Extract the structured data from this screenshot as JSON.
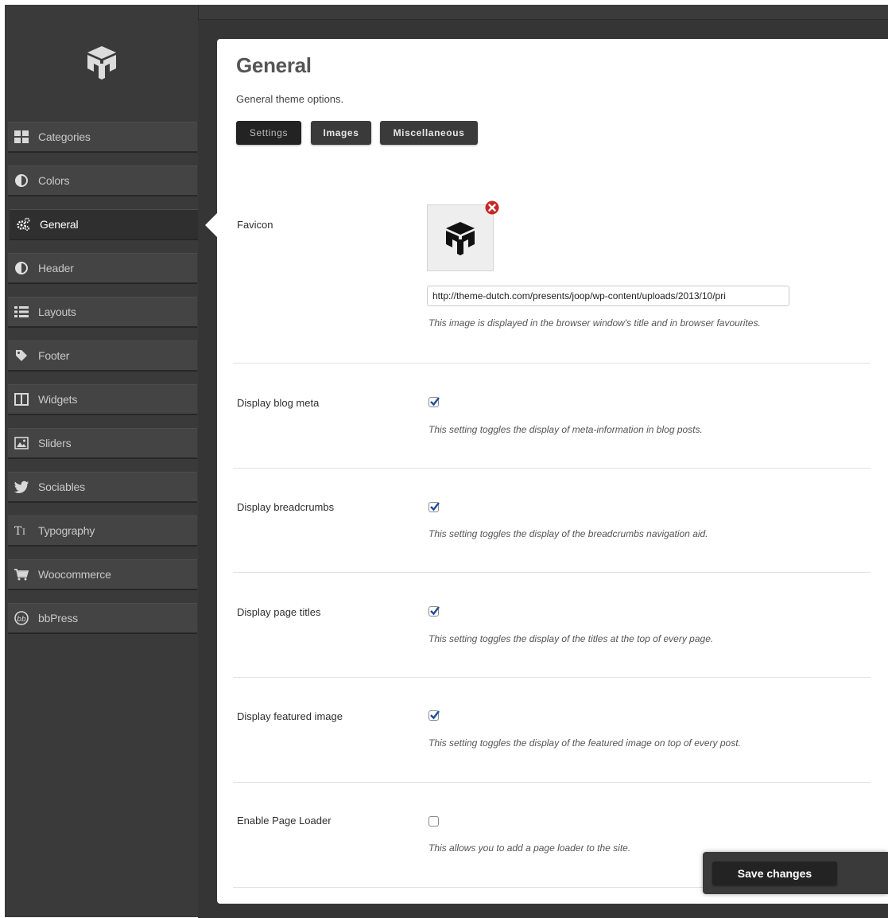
{
  "sidebar": {
    "items": [
      {
        "label": "Categories",
        "icon": "grid-icon"
      },
      {
        "label": "Colors",
        "icon": "contrast-icon"
      },
      {
        "label": "General",
        "icon": "gears-icon",
        "active": true
      },
      {
        "label": "Header",
        "icon": "contrast-icon"
      },
      {
        "label": "Layouts",
        "icon": "list-icon"
      },
      {
        "label": "Footer",
        "icon": "tag-icon"
      },
      {
        "label": "Widgets",
        "icon": "columns-icon"
      },
      {
        "label": "Sliders",
        "icon": "image-icon"
      },
      {
        "label": "Sociables",
        "icon": "twitter-bird-icon"
      },
      {
        "label": "Typography",
        "icon": "typography-icon"
      },
      {
        "label": "Woocommerce",
        "icon": "cart-icon"
      },
      {
        "label": "bbPress",
        "icon": "bbpress-icon"
      }
    ]
  },
  "main": {
    "title": "General",
    "description": "General theme options.",
    "tabs": [
      {
        "label": "Settings",
        "active": true
      },
      {
        "label": "Images",
        "active": false
      },
      {
        "label": "Miscellaneous",
        "active": false
      }
    ],
    "favicon": {
      "label": "Favicon",
      "url_value": "http://theme-dutch.com/presents/joop/wp-content/uploads/2013/10/pri",
      "description": "This image is displayed in the browser window's title and in browser favourites."
    },
    "settings": [
      {
        "label": "Display blog meta",
        "checked": true,
        "description": "This setting toggles the display of meta-information in blog posts."
      },
      {
        "label": "Display breadcrumbs",
        "checked": true,
        "description": "This setting toggles the display of the breadcrumbs navigation aid."
      },
      {
        "label": "Display page titles",
        "checked": true,
        "description": "This setting toggles the display of the titles at the top of every page."
      },
      {
        "label": "Display featured image",
        "checked": true,
        "description": "This setting toggles the display of the featured image on top of every post."
      },
      {
        "label": "Enable Page Loader",
        "checked": false,
        "description": "This allows you to add a page loader to the site."
      }
    ],
    "save_label": "Save changes"
  },
  "colors": {
    "sidebar_bg": "#3a3a3a",
    "active_item_bg": "#2f2f2f",
    "checkbox_check": "#1f4f9a",
    "remove_icon": "#c62828"
  }
}
